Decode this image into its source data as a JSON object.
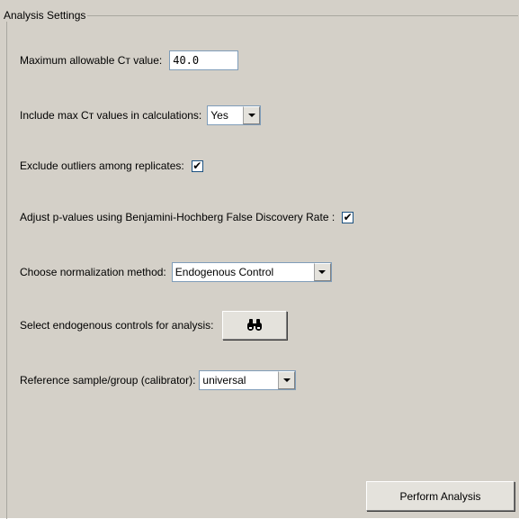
{
  "group": {
    "title": "Analysis Settings"
  },
  "max_ct": {
    "label": "Maximum allowable Cт value:",
    "value": "40.0"
  },
  "include_max": {
    "label": "Include max Cт values in calculations:",
    "selected": "Yes"
  },
  "exclude_outliers": {
    "label": "Exclude outliers among replicates:",
    "checked": true
  },
  "adjust_pvalues": {
    "label": "Adjust p-values using Benjamini-Hochberg False Discovery Rate :",
    "checked": true
  },
  "normalization": {
    "label": "Choose normalization method:",
    "selected": "Endogenous Control"
  },
  "endogenous": {
    "label": "Select endogenous controls for analysis:",
    "icon": "binoculars-icon"
  },
  "reference": {
    "label": "Reference sample/group (calibrator):",
    "selected": "universal"
  },
  "actions": {
    "perform_label": "Perform Analysis"
  },
  "check_mark": "✔"
}
